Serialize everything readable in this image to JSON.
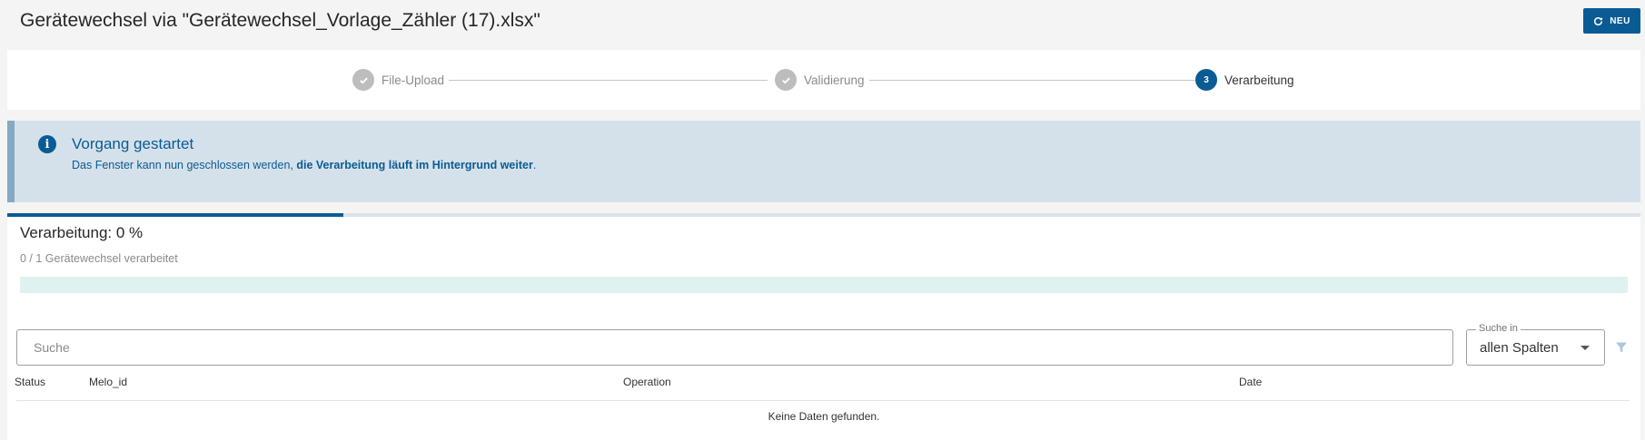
{
  "header": {
    "title": "Gerätewechsel via \"Gerätewechsel_Vorlage_Zähler (17).xlsx\"",
    "new_button_label": "NEU",
    "new_button_icon": "refresh-icon"
  },
  "stepper": {
    "steps": [
      {
        "label": "File-Upload",
        "state": "done",
        "icon": "check-icon"
      },
      {
        "label": "Validierung",
        "state": "done",
        "icon": "check-icon"
      },
      {
        "label": "Verarbeitung",
        "state": "active",
        "number": "3"
      }
    ]
  },
  "alert": {
    "icon": "info-icon",
    "title": "Vorgang gestartet",
    "text_prefix": "Das Fenster kann nun geschlossen werden, ",
    "text_bold": "die Verarbeitung läuft im Hintergrund weiter",
    "text_suffix": "."
  },
  "processing": {
    "title": "Verarbeitung: 0 %",
    "count_text": "0 / 1 Gerätewechsel verarbeitet",
    "progress_fraction": 0,
    "top_progress_fraction": 0.206
  },
  "search": {
    "placeholder": "Suche",
    "scope_label": "Suche in",
    "scope_value": "allen Spalten",
    "filter_icon": "filter-icon"
  },
  "table": {
    "columns": [
      "Status",
      "Melo_id",
      "Operation",
      "Date"
    ],
    "empty_message": "Keine Daten gefunden."
  },
  "colors": {
    "primary": "#0a5b94",
    "alert_bg": "#d5e1ea",
    "progress_track": "#dff2ef"
  }
}
